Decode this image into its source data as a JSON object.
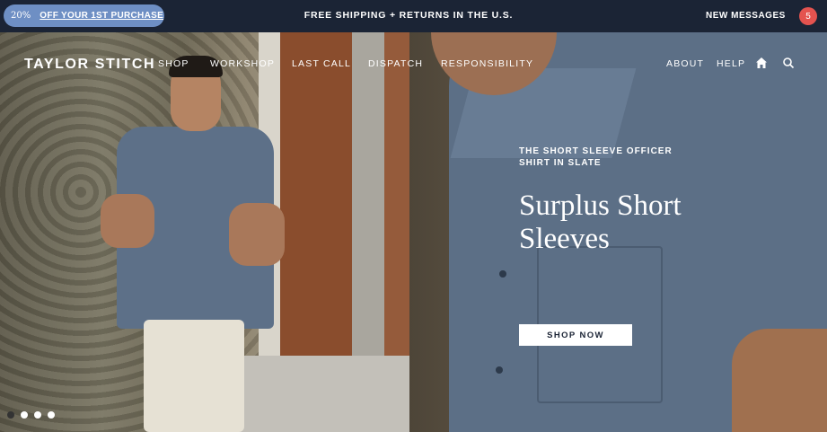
{
  "topbar": {
    "promo_percent": "20%",
    "promo_offer": "OFF YOUR 1ST PURCHASE",
    "shipping": "FREE SHIPPING + RETURNS IN THE U.S.",
    "new_messages": "NEW  MESSAGES",
    "message_count": "5"
  },
  "header": {
    "logo": "TAYLOR STITCH",
    "nav_left": [
      "SHOP",
      "WORKSHOP",
      "LAST CALL",
      "DISPATCH",
      "RESPONSIBILITY"
    ],
    "nav_right": [
      "ABOUT",
      "HELP"
    ],
    "icons": [
      "home-icon",
      "search-icon"
    ]
  },
  "hero": {
    "eyebrow": "THE SHORT SLEEVE OFFICER SHIRT IN SLATE",
    "headline": "Surplus Short Sleeves",
    "cta": "SHOP NOW"
  },
  "carousel": {
    "slide_count": 4,
    "active_index": 0
  },
  "colors": {
    "topbar_bg": "#1b2435",
    "promo_bg": "#6e8fc4",
    "badge_bg": "#e4534f"
  }
}
